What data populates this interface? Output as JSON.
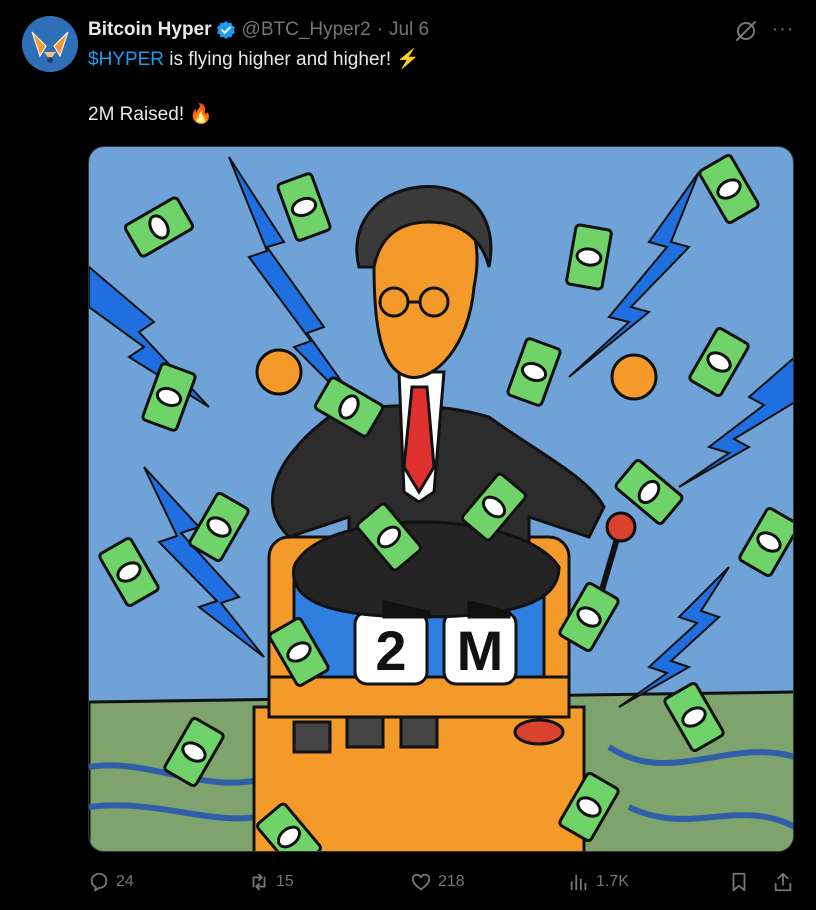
{
  "tweet": {
    "author_name": "Bitcoin Hyper",
    "author_handle": "@BTC_Hyper2",
    "separator": "·",
    "date": "Jul 6",
    "cashtag": "$HYPER",
    "text_rest": " is flying higher and higher! ⚡",
    "line2": "2M Raised! 🔥",
    "media_overlay_text": [
      "2",
      "M"
    ],
    "stats": {
      "replies": "24",
      "reposts": "15",
      "likes": "218",
      "views": "1.7K"
    }
  },
  "icons": {
    "avatar": "bitcoin-hyper-logo",
    "verified": "verified-badge-icon",
    "grok": "grok-icon",
    "more": "more-icon",
    "reply": "reply-icon",
    "repost": "repost-icon",
    "like": "like-icon",
    "views": "views-icon",
    "bookmark": "bookmark-icon",
    "share": "share-icon"
  },
  "colors": {
    "background": "#000000",
    "text": "#e7e9ea",
    "secondary": "#71767b",
    "accent": "#1d9bf0",
    "sky": "#6fa3d8",
    "grass": "#7fa36d",
    "machine": "#f39a2a",
    "money": "#6fd36a",
    "lightning": "#1f6fe0"
  }
}
